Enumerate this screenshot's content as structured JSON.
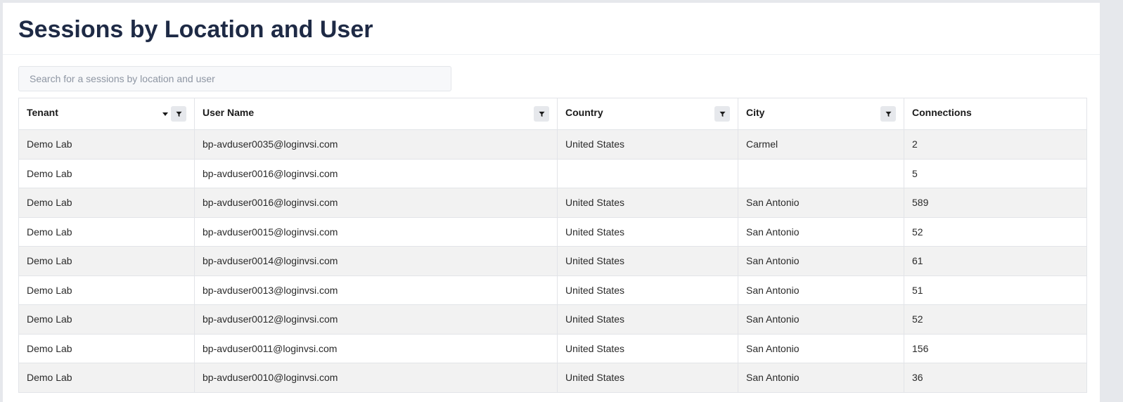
{
  "page": {
    "title": "Sessions by Location and User"
  },
  "search": {
    "placeholder": "Search for a sessions by location and user",
    "value": ""
  },
  "table": {
    "columns": {
      "tenant": "Tenant",
      "user_name": "User Name",
      "country": "Country",
      "city": "City",
      "connections": "Connections"
    },
    "sort": {
      "column": "tenant",
      "direction": "descending",
      "icon": "sort-desc-icon"
    },
    "filter_icon": "funnel-icon",
    "rows": [
      {
        "tenant": "Demo Lab",
        "user_name": "bp-avduser0035@loginvsi.com",
        "country": "United States",
        "city": "Carmel",
        "connections": "2"
      },
      {
        "tenant": "Demo Lab",
        "user_name": "bp-avduser0016@loginvsi.com",
        "country": "",
        "city": "",
        "connections": "5"
      },
      {
        "tenant": "Demo Lab",
        "user_name": "bp-avduser0016@loginvsi.com",
        "country": "United States",
        "city": "San Antonio",
        "connections": "589"
      },
      {
        "tenant": "Demo Lab",
        "user_name": "bp-avduser0015@loginvsi.com",
        "country": "United States",
        "city": "San Antonio",
        "connections": "52"
      },
      {
        "tenant": "Demo Lab",
        "user_name": "bp-avduser0014@loginvsi.com",
        "country": "United States",
        "city": "San Antonio",
        "connections": "61"
      },
      {
        "tenant": "Demo Lab",
        "user_name": "bp-avduser0013@loginvsi.com",
        "country": "United States",
        "city": "San Antonio",
        "connections": "51"
      },
      {
        "tenant": "Demo Lab",
        "user_name": "bp-avduser0012@loginvsi.com",
        "country": "United States",
        "city": "San Antonio",
        "connections": "52"
      },
      {
        "tenant": "Demo Lab",
        "user_name": "bp-avduser0011@loginvsi.com",
        "country": "United States",
        "city": "San Antonio",
        "connections": "156"
      },
      {
        "tenant": "Demo Lab",
        "user_name": "bp-avduser0010@loginvsi.com",
        "country": "United States",
        "city": "San Antonio",
        "connections": "36"
      }
    ]
  },
  "colors": {
    "title": "#1e2a45",
    "row_stripe": "#f2f2f2",
    "filter_button_bg": "#e6e8ec",
    "page_background": "#e6e8ec"
  }
}
